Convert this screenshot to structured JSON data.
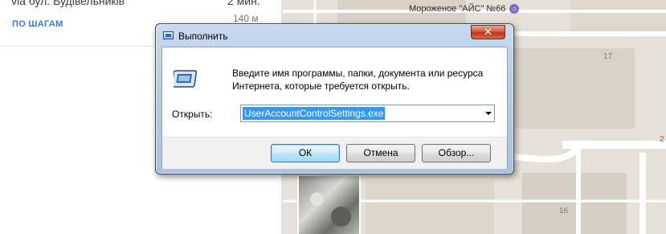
{
  "map": {
    "poi_label": "Мороженое \"АЙС\" №66",
    "house_numbers": [
      "17",
      "16",
      "2"
    ]
  },
  "directions": {
    "via": "via бул. Будівельників",
    "time": "2 мин.",
    "distance": "140 м",
    "steps_link": "ПО ШАГАМ"
  },
  "run_dialog": {
    "title": "Выполнить",
    "close_label": "✕",
    "description_line1": "Введите имя программы, папки, документа или ресурса",
    "description_line2": "Интернета, которые требуется открыть.",
    "open_label": "Открыть:",
    "open_value": "UserAccountControlSettings.exe",
    "buttons": {
      "ok": "ОК",
      "cancel": "Отмена",
      "browse": "Обзор..."
    }
  }
}
